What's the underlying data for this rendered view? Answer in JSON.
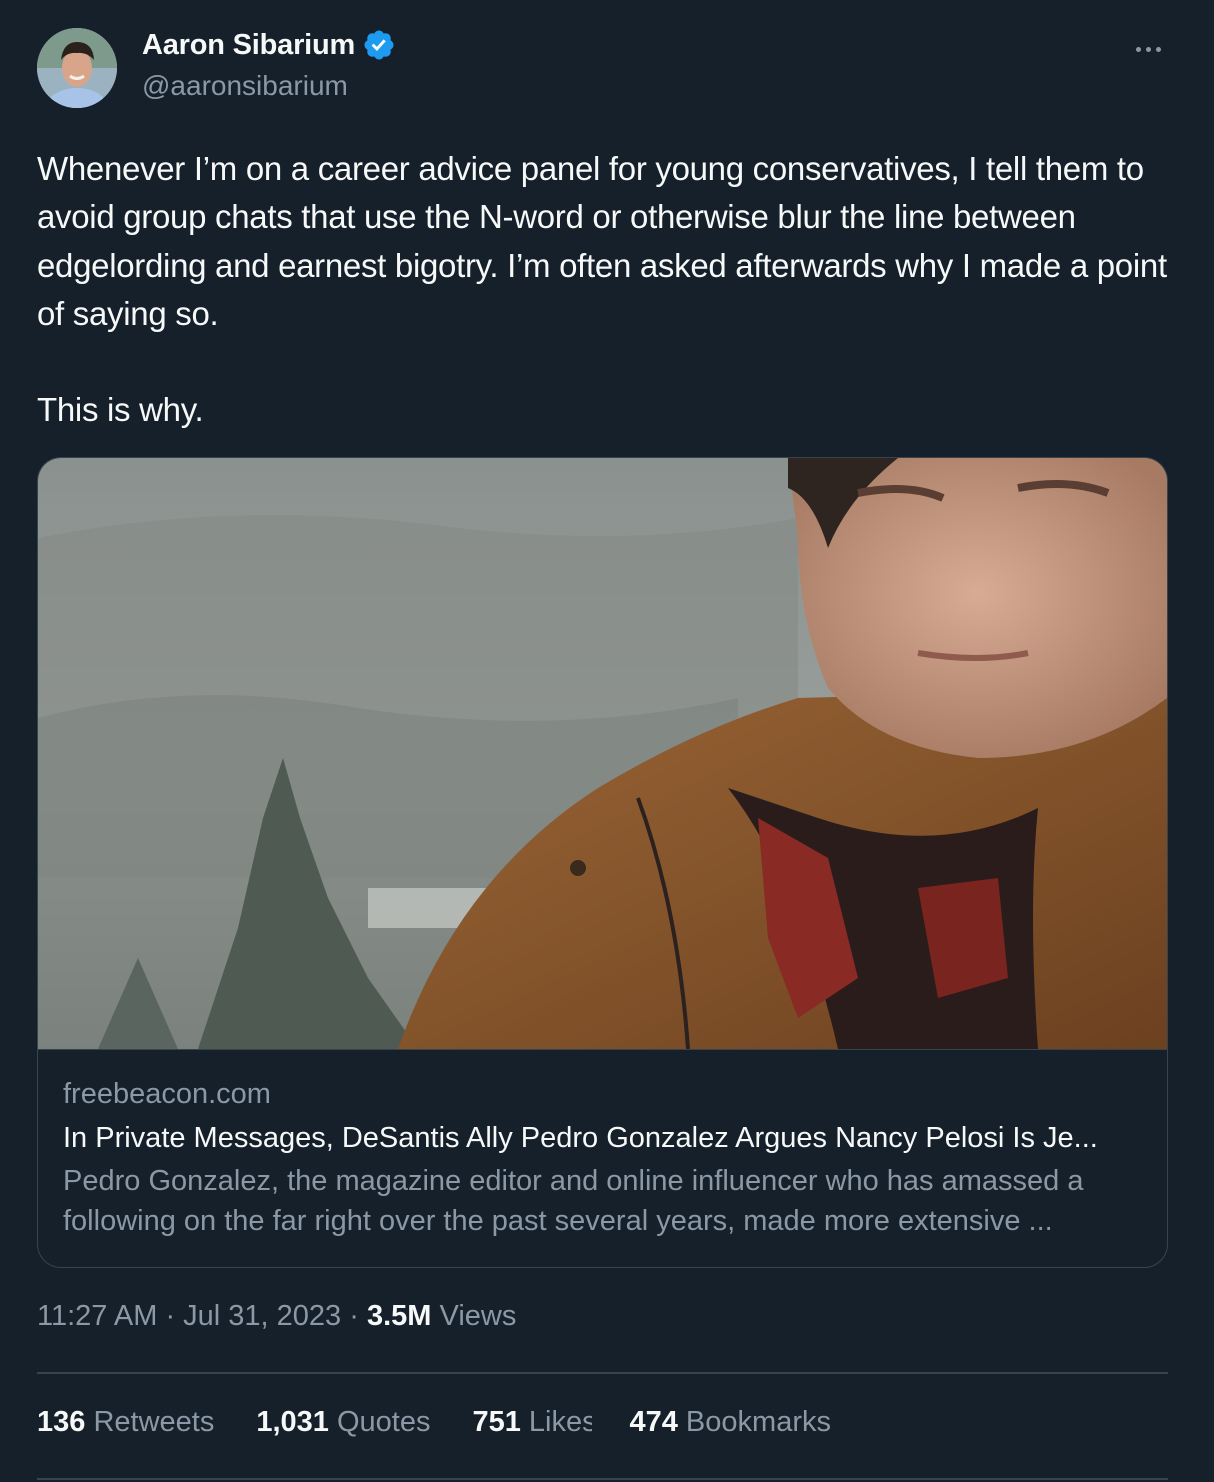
{
  "author": {
    "display_name": "Aaron Sibarium",
    "handle": "@aaronsibarium",
    "verified": true,
    "colors": {
      "verified_badge": "#1d9bf0"
    }
  },
  "tweet": {
    "text": "Whenever I’m on a career advice panel for young conservatives, I tell them to avoid group chats that use the N-word or otherwise blur the line between edgelording and earnest bigotry. I’m often asked afterwards why I made a point of saying so.\n\nThis is why."
  },
  "link_card": {
    "domain": "freebeacon.com",
    "title": "In Private Messages, DeSantis Ally Pedro Gonzalez Argues Nancy Pelosi Is Je...",
    "description": "Pedro Gonzalez, the magazine editor and online influencer who has amassed a following on the far right over the past several years, made more extensive ..."
  },
  "meta": {
    "time": "11:27 AM",
    "separator1": " · ",
    "date": "Jul 31, 2023",
    "separator2": " · ",
    "views_count": "3.5M",
    "views_label": " Views"
  },
  "stats": {
    "retweets_count": "136",
    "retweets_label": " Retweets",
    "quotes_count": "1,031",
    "quotes_label": " Quotes",
    "likes_count": "751",
    "likes_label": " Likes",
    "bookmarks_count": "474",
    "bookmarks_label": " Bookmarks"
  },
  "icons": {
    "more": "more-horizontal-icon",
    "verified": "verified-badge-icon"
  },
  "theme": {
    "background": "#15202b",
    "border": "#38444d",
    "text": "#f7f9f9",
    "secondary": "#8b98a5"
  }
}
